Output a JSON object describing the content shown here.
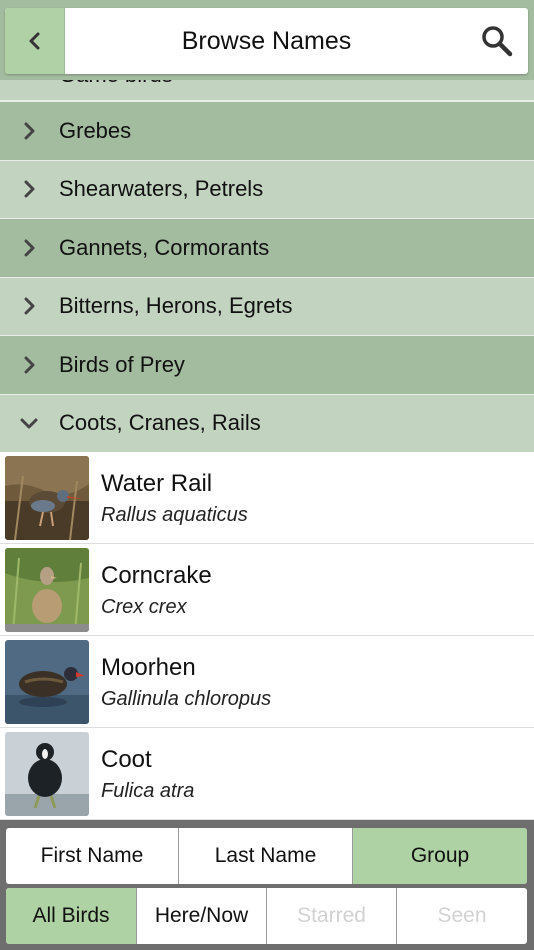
{
  "header": {
    "title": "Browse Names",
    "back_icon": "chevron-left-icon",
    "search_icon": "search-icon"
  },
  "groups": {
    "partial_label": "Game birds",
    "items": [
      {
        "label": "Grebes",
        "expanded": false
      },
      {
        "label": "Shearwaters, Petrels",
        "expanded": false
      },
      {
        "label": "Gannets, Cormorants",
        "expanded": false
      },
      {
        "label": "Bitterns, Herons, Egrets",
        "expanded": false
      },
      {
        "label": "Birds of Prey",
        "expanded": false
      },
      {
        "label": "Coots, Cranes, Rails",
        "expanded": true
      }
    ]
  },
  "birds": [
    {
      "name": "Water Rail",
      "scientific": "Rallus aquaticus"
    },
    {
      "name": "Corncrake",
      "scientific": "Crex crex"
    },
    {
      "name": "Moorhen",
      "scientific": "Gallinula chloropus"
    },
    {
      "name": "Coot",
      "scientific": "Fulica atra"
    }
  ],
  "sort_control": {
    "options": [
      "First Name",
      "Last Name",
      "Group"
    ],
    "selected": "Group"
  },
  "filter_control": {
    "options": [
      "All Birds",
      "Here/Now",
      "Starred",
      "Seen"
    ],
    "selected": "All Birds",
    "disabled": [
      "Starred",
      "Seen"
    ]
  },
  "colors": {
    "group_dark": "#a3bc9f",
    "group_light": "#c2d3c0",
    "accent": "#aed2a3",
    "toolbar_bg": "#6e6e6e"
  }
}
